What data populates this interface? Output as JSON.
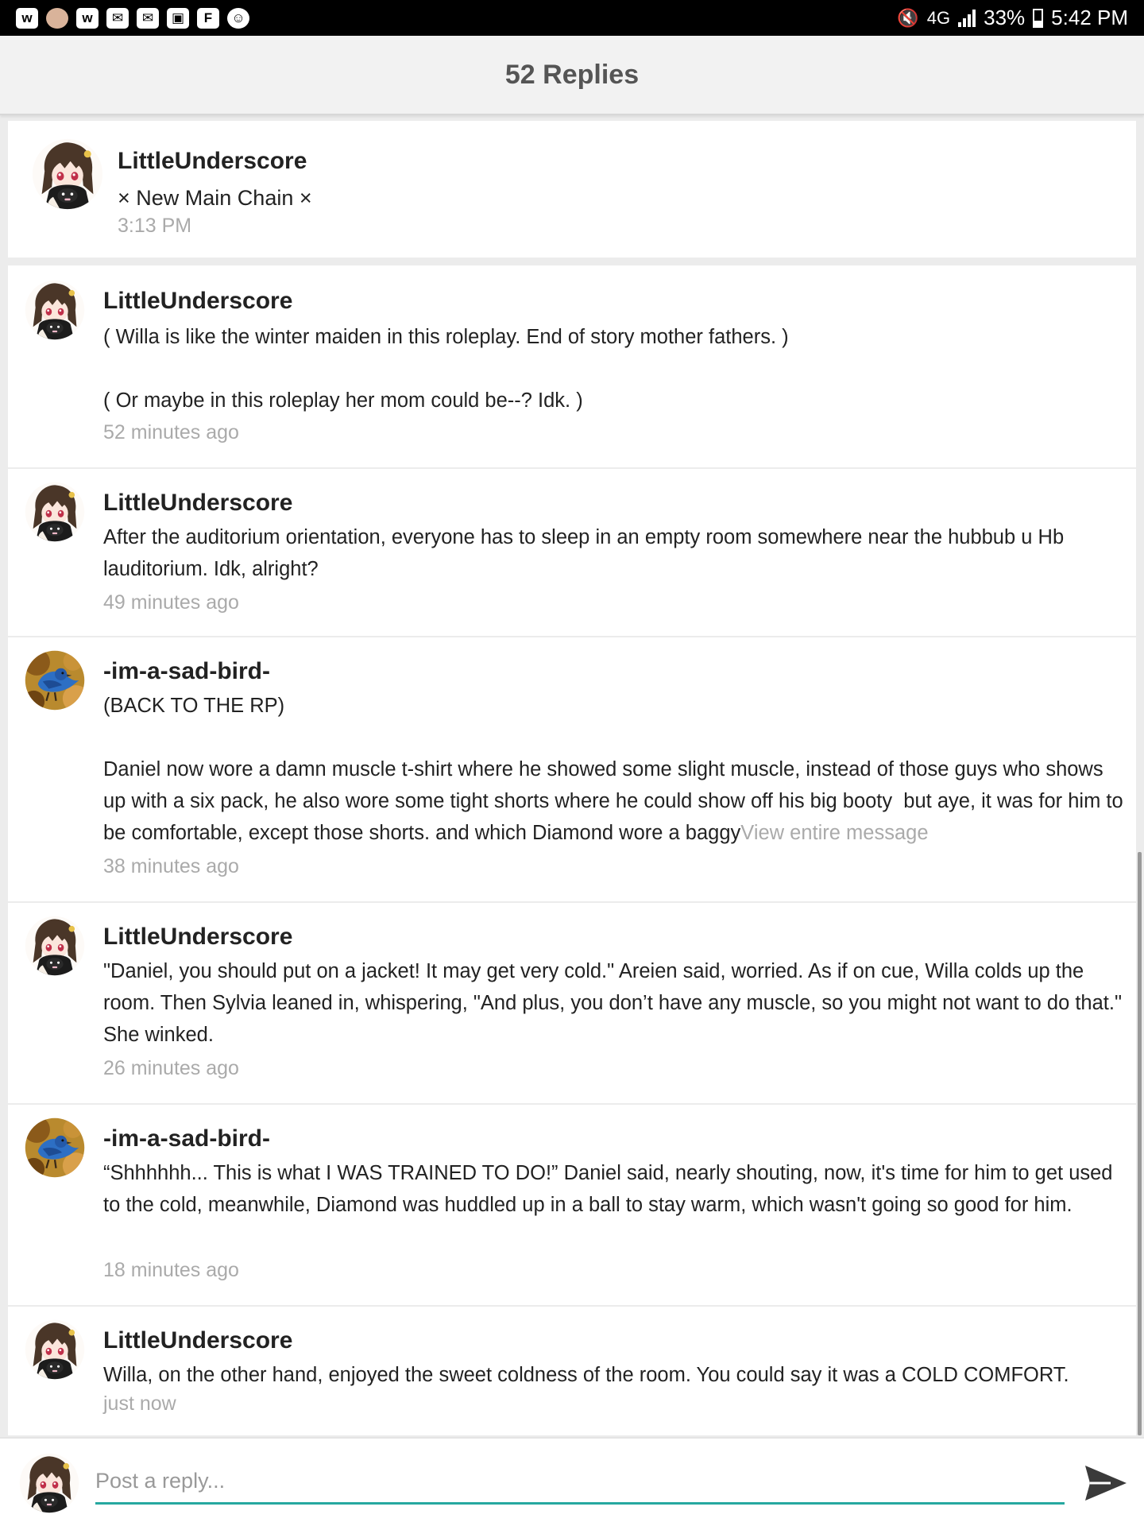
{
  "status_bar": {
    "left_icons": [
      "w-app-icon",
      "avatar-notification-icon",
      "w-app-icon",
      "mail-icon",
      "mail-icon",
      "image-icon",
      "flipboard-icon",
      "smiley-icon"
    ],
    "network": "4G",
    "battery": "33%",
    "battery_level": 0.33,
    "time": "5:42 PM"
  },
  "header": {
    "title": "52 Replies"
  },
  "original_post": {
    "author": "LittleUnderscore",
    "title": "× New Main Chain ×",
    "time": "3:13 PM",
    "avatar": "anime-girl-avatar"
  },
  "replies": [
    {
      "author": "LittleUnderscore",
      "avatar": "anime-girl-avatar",
      "text": "( Willa is like the winter maiden in this roleplay. End of story mother fathers. )\n\n( Or maybe in this roleplay her mom could be--? Idk. )",
      "time": "52 minutes ago"
    },
    {
      "author": "LittleUnderscore",
      "avatar": "anime-girl-avatar",
      "text": "After the auditorium orientation, everyone has to sleep in an empty room somewhere near the hubbub u Hb lauditorium. Idk, alright?",
      "time": "49 minutes ago"
    },
    {
      "author": "-im-a-sad-bird-",
      "avatar": "bluebird-avatar",
      "text": "(BACK TO THE RP)\n\nDaniel now wore a damn muscle t-shirt where he showed some slight muscle, instead of those guys who shows up with a six pack, he also wore some tight shorts where he could show off his big booty  but aye, it was for him to be comfortable, except those shorts. and which Diamond wore a baggy",
      "view_more": "View entire message",
      "time": "38 minutes ago"
    },
    {
      "author": "LittleUnderscore",
      "avatar": "anime-girl-avatar",
      "text": "\"Daniel, you should put on a jacket! It may get very cold.\" Areien said, worried. As if on cue, Willa colds up the room. Then Sylvia leaned in, whispering, \"And plus, you don’t have any muscle, so you might not want to do that.\" She winked.",
      "time": "26 minutes ago"
    },
    {
      "author": "-im-a-sad-bird-",
      "avatar": "bluebird-avatar",
      "text": "“Shhhhhh... This is what I WAS TRAINED TO DO!” Daniel said, nearly shouting, now, it's time for him to get used to the cold, meanwhile, Diamond was huddled up in a ball to stay warm, which wasn't going so good for him.",
      "time": "18 minutes ago"
    },
    {
      "author": "LittleUnderscore",
      "avatar": "anime-girl-avatar",
      "text": "Willa, on the other hand, enjoyed the sweet coldness of the room. You could say it was a COLD COMFORT.",
      "time": "just now"
    }
  ],
  "reply_bar": {
    "placeholder": "Post a reply...",
    "value": "",
    "avatar": "anime-girl-avatar",
    "send_icon": "send-icon"
  },
  "colors": {
    "accent": "#26a8a0",
    "timestamp": "#aaaaaa",
    "header_bg": "#f2f2f2"
  }
}
